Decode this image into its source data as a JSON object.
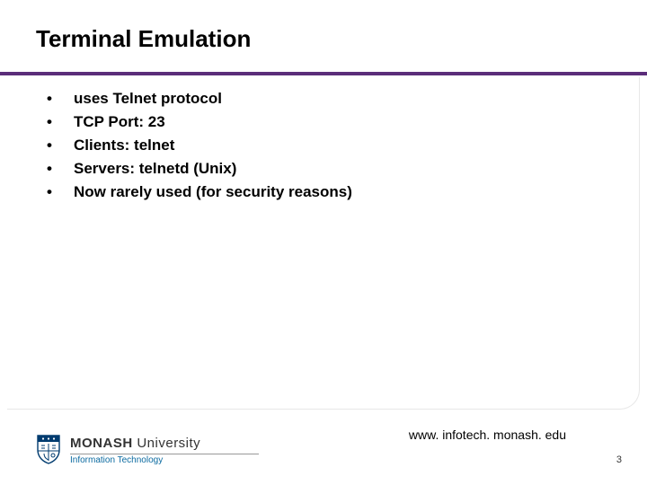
{
  "title": "Terminal Emulation",
  "bullets": [
    "uses Telnet protocol",
    "TCP Port: 23",
    "Clients: telnet",
    "Servers: telnetd (Unix)",
    "Now rarely used (for security reasons)"
  ],
  "footer_url": "www. infotech. monash. edu",
  "page_number": "3",
  "logo": {
    "wordmark_bold": "MONASH",
    "wordmark_light": " University",
    "subtext": "Information Technology"
  },
  "colors": {
    "accent": "#5b2d7a",
    "shield": "#003b6f",
    "sub": "#0b6aa0"
  }
}
